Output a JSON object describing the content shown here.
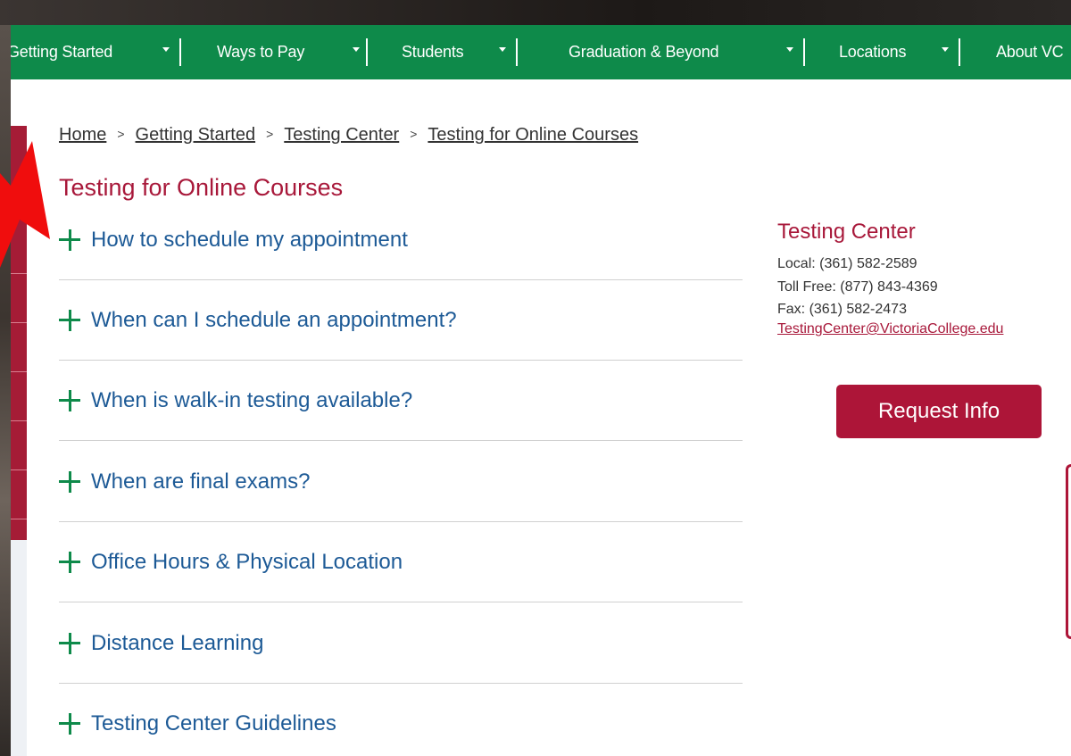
{
  "nav": {
    "items": [
      {
        "label": "Getting Started"
      },
      {
        "label": "Ways to Pay"
      },
      {
        "label": "Students"
      },
      {
        "label": "Graduation & Beyond"
      },
      {
        "label": "Locations"
      },
      {
        "label": "About VC"
      }
    ]
  },
  "breadcrumb": {
    "items": [
      "Home",
      "Getting Started",
      "Testing Center",
      "Testing for Online Courses"
    ],
    "separator": ">"
  },
  "page": {
    "title": "Testing for Online Courses"
  },
  "accordion": {
    "items": [
      "How to schedule my appointment",
      "When can I schedule an appointment?",
      "When is walk-in testing available?",
      "When are final exams?",
      "Office Hours & Physical Location",
      "Distance Learning",
      "Testing Center Guidelines"
    ]
  },
  "contact": {
    "title": "Testing Center",
    "local": "Local: (361) 582-2589",
    "toll_free": "Toll Free: (877) 843-4369",
    "fax": "Fax:  (361) 582-2473",
    "email": "TestingCenter@VictoriaCollege.edu"
  },
  "request_button": {
    "label": "Request Info"
  },
  "colors": {
    "nav_green": "#0e8a4a",
    "brand_red": "#a8183a",
    "link_blue": "#1d5a96"
  }
}
